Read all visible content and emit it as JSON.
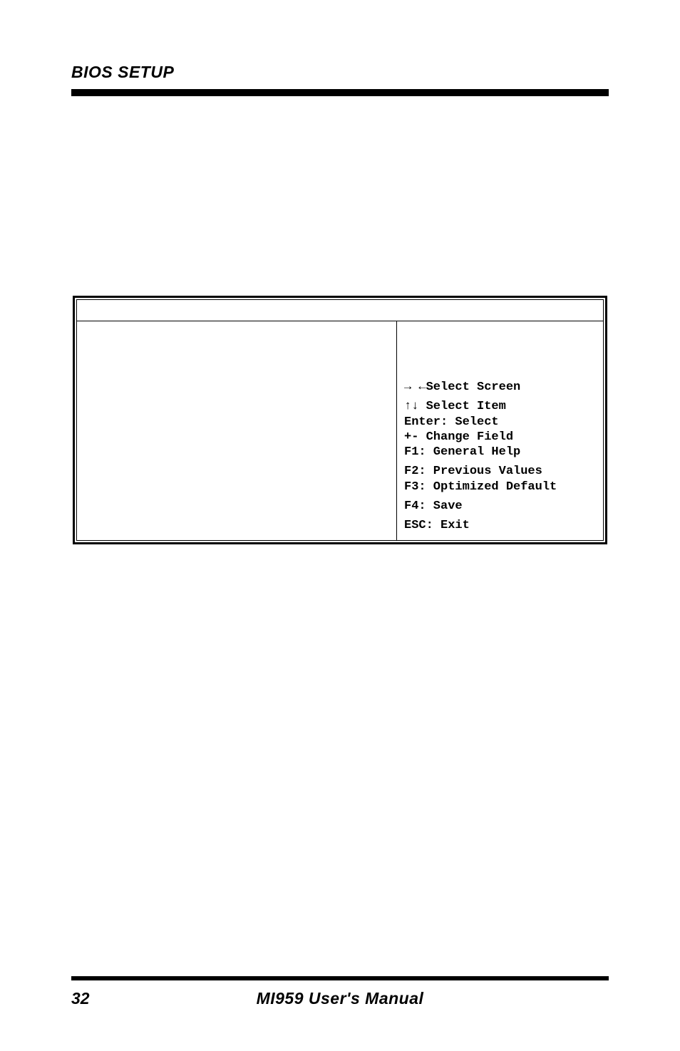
{
  "header": {
    "title": "BIOS SETUP"
  },
  "bios": {
    "help": {
      "select_screen": "→ ←Select Screen",
      "select_item": "↑↓ Select Item",
      "enter": "Enter: Select",
      "change": "+-  Change Field",
      "f1": "F1: General Help",
      "f2": "F2: Previous Values",
      "f3": "F3: Optimized Default",
      "f4": "F4: Save",
      "esc": "ESC: Exit"
    }
  },
  "footer": {
    "page": "32",
    "title": "MI959 User's Manual"
  }
}
